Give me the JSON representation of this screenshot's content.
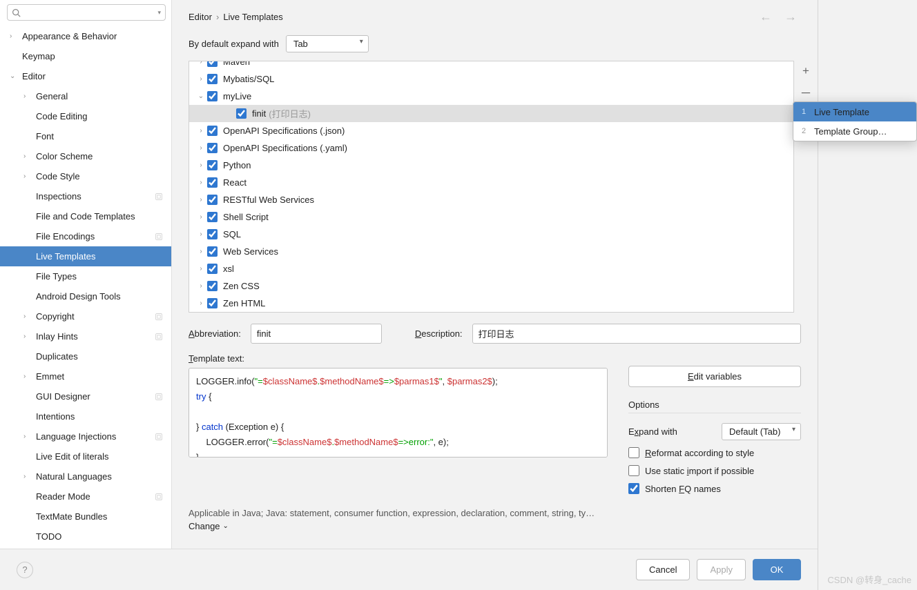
{
  "breadcrumb": {
    "parent": "Editor",
    "current": "Live Templates"
  },
  "nav": {
    "back_icon": "←",
    "forward_icon": "→"
  },
  "expand": {
    "label": "By default expand with",
    "value": "Tab"
  },
  "sidebar": {
    "items": [
      {
        "label": "Appearance & Behavior",
        "depth": 0,
        "chev": "›"
      },
      {
        "label": "Keymap",
        "depth": 0,
        "chev": ""
      },
      {
        "label": "Editor",
        "depth": 0,
        "chev": "⌄"
      },
      {
        "label": "General",
        "depth": 1,
        "chev": "›"
      },
      {
        "label": "Code Editing",
        "depth": 1,
        "chev": ""
      },
      {
        "label": "Font",
        "depth": 1,
        "chev": ""
      },
      {
        "label": "Color Scheme",
        "depth": 1,
        "chev": "›"
      },
      {
        "label": "Code Style",
        "depth": 1,
        "chev": "›"
      },
      {
        "label": "Inspections",
        "depth": 1,
        "chev": "",
        "gear": true
      },
      {
        "label": "File and Code Templates",
        "depth": 1,
        "chev": ""
      },
      {
        "label": "File Encodings",
        "depth": 1,
        "chev": "",
        "gear": true
      },
      {
        "label": "Live Templates",
        "depth": 1,
        "chev": "",
        "selected": true
      },
      {
        "label": "File Types",
        "depth": 1,
        "chev": ""
      },
      {
        "label": "Android Design Tools",
        "depth": 1,
        "chev": ""
      },
      {
        "label": "Copyright",
        "depth": 1,
        "chev": "›",
        "gear": true
      },
      {
        "label": "Inlay Hints",
        "depth": 1,
        "chev": "›",
        "gear": true
      },
      {
        "label": "Duplicates",
        "depth": 1,
        "chev": ""
      },
      {
        "label": "Emmet",
        "depth": 1,
        "chev": "›"
      },
      {
        "label": "GUI Designer",
        "depth": 1,
        "chev": "",
        "gear": true
      },
      {
        "label": "Intentions",
        "depth": 1,
        "chev": ""
      },
      {
        "label": "Language Injections",
        "depth": 1,
        "chev": "›",
        "gear": true
      },
      {
        "label": "Live Edit of literals",
        "depth": 1,
        "chev": ""
      },
      {
        "label": "Natural Languages",
        "depth": 1,
        "chev": "›"
      },
      {
        "label": "Reader Mode",
        "depth": 1,
        "chev": "",
        "gear": true
      },
      {
        "label": "TextMate Bundles",
        "depth": 1,
        "chev": ""
      },
      {
        "label": "TODO",
        "depth": 1,
        "chev": ""
      }
    ]
  },
  "templates": [
    {
      "label": "Maven",
      "exp": "›",
      "checked": true,
      "indent": 0,
      "clipped": true
    },
    {
      "label": "Mybatis/SQL",
      "exp": "›",
      "checked": true,
      "indent": 0
    },
    {
      "label": "myLive",
      "exp": "⌄",
      "checked": true,
      "indent": 0
    },
    {
      "label": "finit",
      "exp": "",
      "checked": true,
      "indent": 2,
      "hint": "(打印日志)",
      "sel": true
    },
    {
      "label": "OpenAPI Specifications (.json)",
      "exp": "›",
      "checked": true,
      "indent": 0
    },
    {
      "label": "OpenAPI Specifications (.yaml)",
      "exp": "›",
      "checked": true,
      "indent": 0
    },
    {
      "label": "Python",
      "exp": "›",
      "checked": true,
      "indent": 0
    },
    {
      "label": "React",
      "exp": "›",
      "checked": true,
      "indent": 0
    },
    {
      "label": "RESTful Web Services",
      "exp": "›",
      "checked": true,
      "indent": 0
    },
    {
      "label": "Shell Script",
      "exp": "›",
      "checked": true,
      "indent": 0
    },
    {
      "label": "SQL",
      "exp": "›",
      "checked": true,
      "indent": 0
    },
    {
      "label": "Web Services",
      "exp": "›",
      "checked": true,
      "indent": 0
    },
    {
      "label": "xsl",
      "exp": "›",
      "checked": true,
      "indent": 0
    },
    {
      "label": "Zen CSS",
      "exp": "›",
      "checked": true,
      "indent": 0
    },
    {
      "label": "Zen HTML",
      "exp": "›",
      "checked": true,
      "indent": 0
    }
  ],
  "toolbar": {
    "add": "+",
    "remove": "－",
    "revert": "↶"
  },
  "form": {
    "abbr_label": "Abbreviation:",
    "abbr_value": "finit",
    "desc_label": "Description:",
    "desc_value": "打印日志",
    "tmpl_label": "Template text:",
    "edit_vars": "Edit variables",
    "options": "Options",
    "expand_label": "Expand with",
    "expand_value": "Default (Tab)",
    "opt1": "Reformat according to style",
    "opt2": "Use static import if possible",
    "opt3": "Shorten FQ names",
    "applicable": "Applicable in Java; Java: statement, consumer function, expression, declaration, comment, string, ty…",
    "change": "Change"
  },
  "code": {
    "l1a": "LOGGER.info(",
    "l1b": "\"=",
    "l1c": "$className$",
    "l1d": ".",
    "l1e": "$methodName$",
    "l1f": "=>",
    "l1g": "$parmas1$",
    "l1h": "\"",
    "l1i": ", ",
    "l1j": "$parmas2$",
    "l1k": ");",
    "l2a": "try",
    "l2b": " {",
    "l3": "",
    "l4a": "} ",
    "l4b": "catch",
    "l4c": " (Exception e) {",
    "l5a": "    LOGGER.error(",
    "l5b": "\"=",
    "l5c": "$className$",
    "l5d": ".",
    "l5e": "$methodName$",
    "l5f": "=>error:\"",
    "l5g": ", e);",
    "l6": "}"
  },
  "footer": {
    "help": "?",
    "cancel": "Cancel",
    "apply": "Apply",
    "ok": "OK"
  },
  "popup": {
    "items": [
      {
        "num": "1",
        "label": "Live Template",
        "sel": true
      },
      {
        "num": "2",
        "label": "Template Group…",
        "sel": false
      }
    ]
  },
  "watermark": "CSDN @转身_cache"
}
